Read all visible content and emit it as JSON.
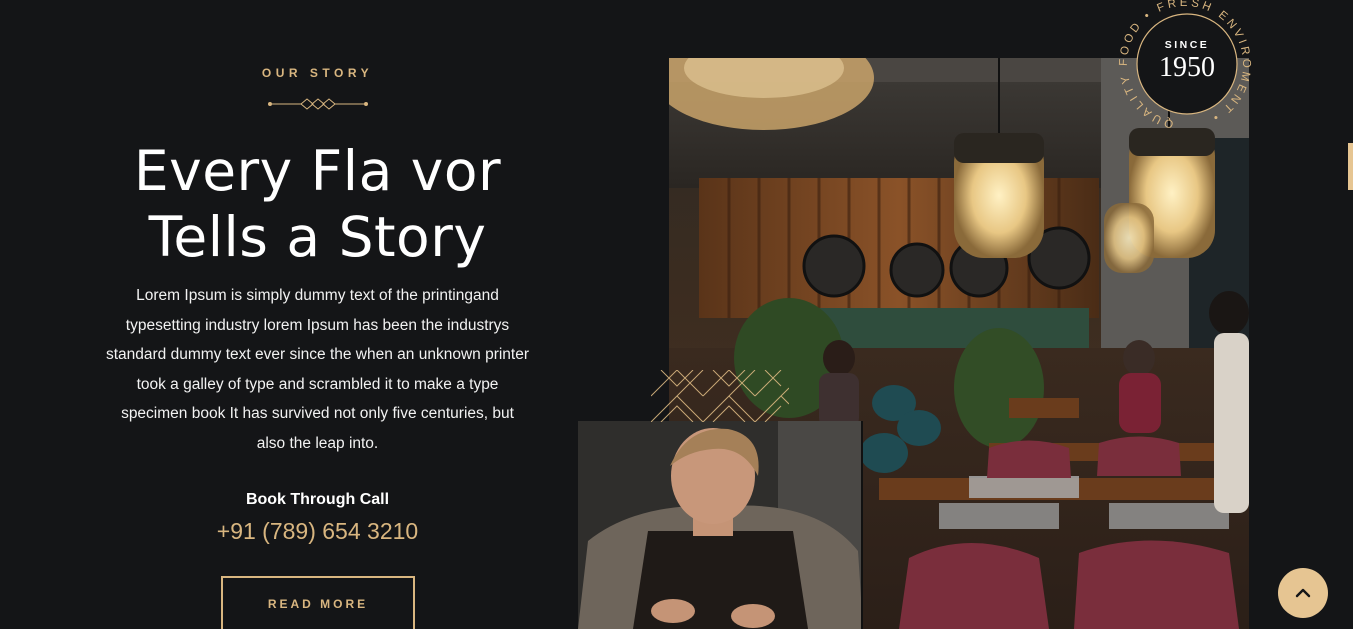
{
  "story": {
    "eyebrow": "OUR STORY",
    "headline_line1": "Every Fla vor",
    "headline_line2": "Tells a Story",
    "body": "Lorem Ipsum is simply dummy text of the printingand typesetting industry lorem Ipsum has been the industrys standard dummy text ever since the when an unknown printer took a galley of type and scrambled it to make a type specimen book It has survived not only five centuries, but also the leap into.",
    "call_label": "Book Through Call",
    "phone": "+91 (789) 654 3210",
    "read_more": "READ MORE"
  },
  "badge": {
    "since": "SINCE",
    "year": "1950",
    "ring_text": "QUALITY FOOD • FRESH ENVIROMENT •"
  },
  "images": {
    "main": "restaurant-interior",
    "secondary": "chef-cooking"
  },
  "icons": {
    "scroll_top": "chevron-up-icon"
  },
  "colors": {
    "background": "#141517",
    "accent": "#d9b680",
    "button_fill": "#e6c592"
  }
}
